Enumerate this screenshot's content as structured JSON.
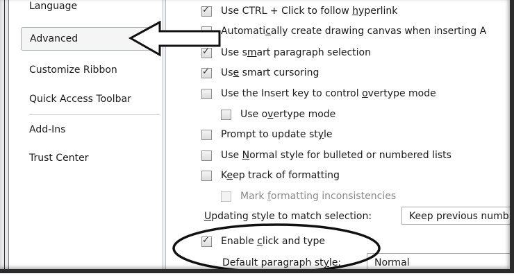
{
  "sidebar": {
    "items": [
      {
        "label": "Language"
      },
      {
        "label": "Advanced"
      },
      {
        "label": "Customize Ribbon"
      },
      {
        "label": "Quick Access Toolbar"
      },
      {
        "label": "Add-Ins"
      },
      {
        "label": "Trust Center"
      }
    ]
  },
  "options": {
    "ctrl_click": {
      "pre": "Use CTRL + Click to follow ",
      "u": "h",
      "post": "yperlink",
      "checked": true
    },
    "drawing_canvas": {
      "pre": "Automati",
      "u": "c",
      "post": "ally create drawing canvas when inserting A",
      "checked": false
    },
    "smart_paragraph": {
      "pre": "Use s",
      "u": "m",
      "post": "art paragraph selection",
      "checked": true
    },
    "smart_cursoring": {
      "pre": "Us",
      "u": "e",
      "post": " smart cursoring",
      "checked": true
    },
    "insert_key": {
      "pre": "Use the Insert key to control ",
      "u": "o",
      "post": "vertype mode",
      "checked": false
    },
    "overtype": {
      "pre": "Use o",
      "u": "v",
      "post": "ertype mode",
      "checked": false
    },
    "prompt_style": {
      "pre": "Prompt to update st",
      "u": "y",
      "post": "le",
      "checked": false
    },
    "normal_style": {
      "pre": "Use ",
      "u": "N",
      "post": "ormal style for bulleted or numbered lists",
      "checked": false
    },
    "track_formatting": {
      "pre": "K",
      "u": "e",
      "post": "ep track of formatting",
      "checked": false
    },
    "mark_inconsistencies": {
      "pre": "Mark ",
      "u": "f",
      "post": "ormatting inconsistencies",
      "checked": false
    },
    "click_and_type": {
      "pre": "Enable ",
      "u": "c",
      "post": "lick and type",
      "checked": true
    }
  },
  "updating_style": {
    "pre": "",
    "u": "U",
    "post": "pdating style to match selection:",
    "value": "Keep previous numb"
  },
  "default_paragraph": {
    "pre": "Default paragraph st",
    "u": "y",
    "post": "le:",
    "value": "Normal"
  },
  "colors": {
    "selected_bg": "#f5f5f5",
    "border": "#a8acb3",
    "disabled_text": "#8a8a8a"
  }
}
